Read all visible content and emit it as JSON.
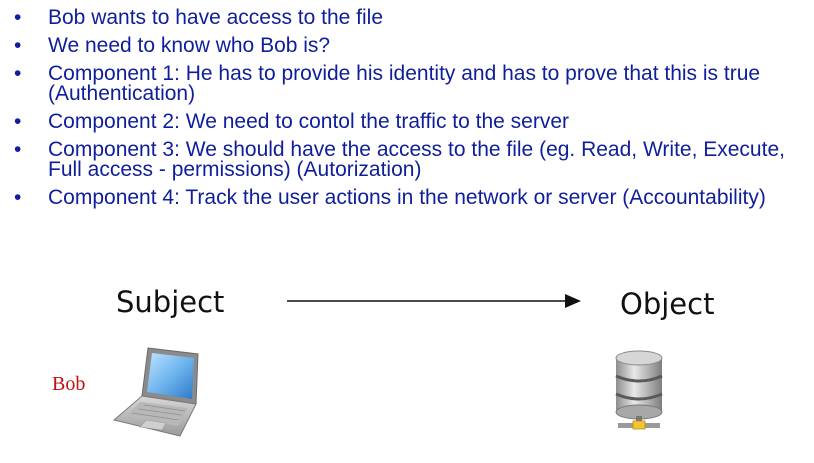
{
  "bullets": [
    "Bob wants to have access to the file",
    "We need to know who Bob is?",
    "Component 1: He has to provide his identity and has to prove that this is true (Authentication)",
    "Component 2: We need to contol the traffic to the server",
    "Component 3:  We should have the access to the file (eg. Read, Write, Execute, Full access - permissions) (Autorization)",
    "Component 4: Track the user actions in the network or server (Accountability)"
  ],
  "bullet_symbol": "•",
  "diagram": {
    "subject_label": "Subject",
    "object_label": "Object",
    "user_label": "Bob",
    "subject_icon": "laptop-icon",
    "object_icon": "database-server-icon"
  },
  "colors": {
    "bullet_text": "#0f1e9a",
    "user_label": "#c01010",
    "diagram_text": "#111111"
  }
}
